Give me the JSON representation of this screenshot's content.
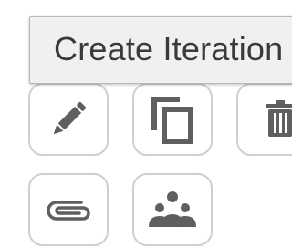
{
  "tooltip": {
    "text": "Create Iteration"
  },
  "toolbar": {
    "buttons": [
      {
        "name": "edit",
        "icon": "pencil-icon"
      },
      {
        "name": "copy",
        "icon": "copy-icon"
      },
      {
        "name": "delete",
        "icon": "trash-icon"
      },
      {
        "name": "attach",
        "icon": "paperclip-icon"
      },
      {
        "name": "group",
        "icon": "group-icon"
      }
    ]
  },
  "colors": {
    "icon": "#5f5f5f",
    "tile_border": "#cfcfcf",
    "tooltip_bg": "#f0f0f0",
    "tooltip_text": "#3a3a3a"
  }
}
